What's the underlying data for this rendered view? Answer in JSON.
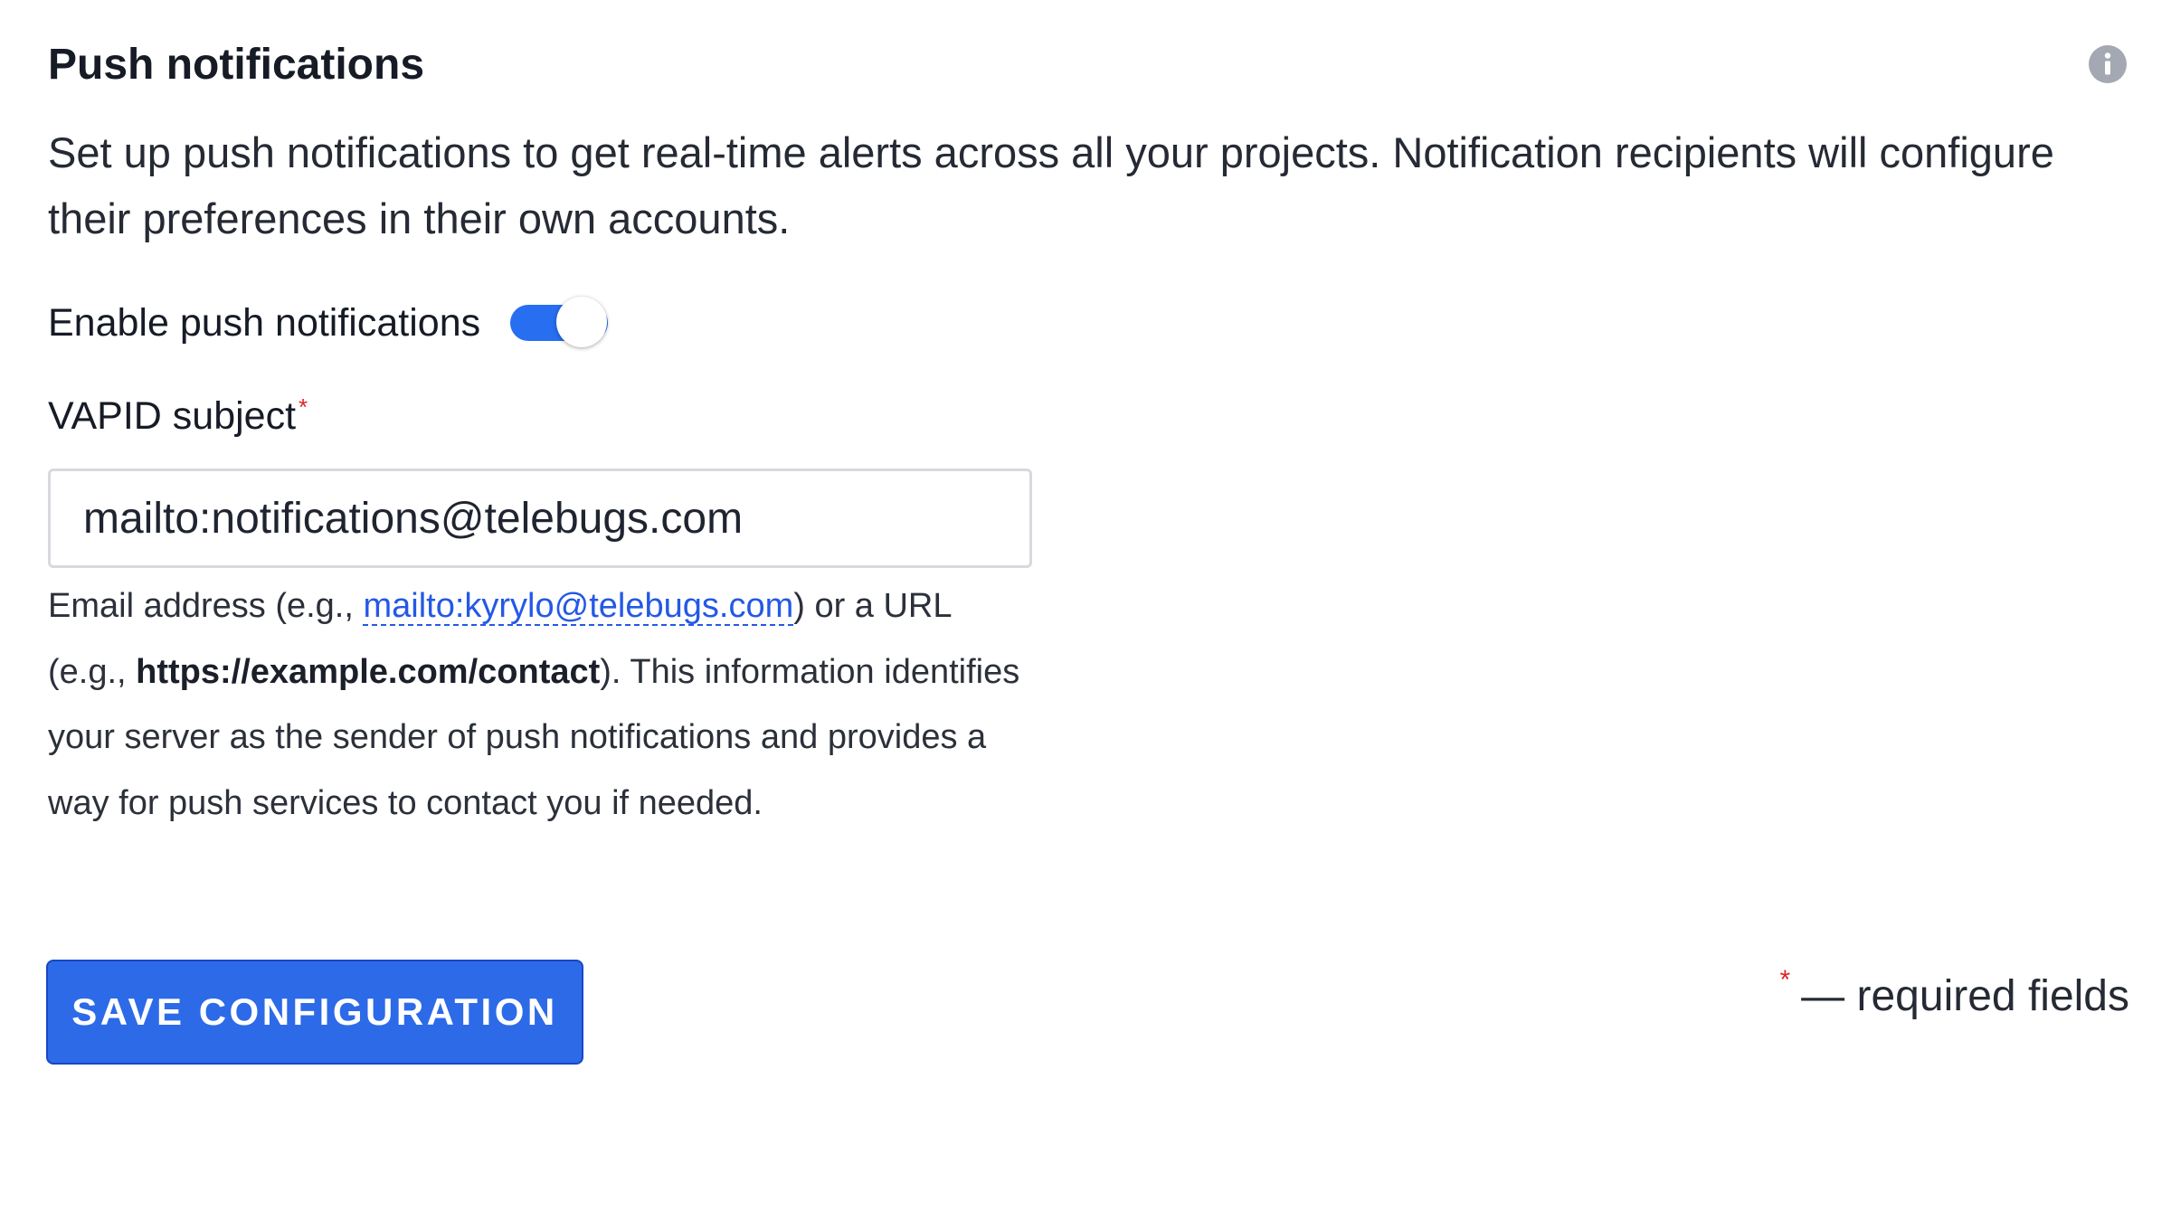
{
  "header": {
    "title": "Push notifications",
    "info_icon": "info-circle-icon"
  },
  "description": "Set up push notifications to get real-time alerts across all your projects. Notification recipients will configure their preferences in their own accounts.",
  "toggle": {
    "label": "Enable push notifications",
    "enabled": true,
    "on_color": "#276ef1"
  },
  "vapid": {
    "label": "VAPID subject",
    "required_mark": "*",
    "value": "mailto:notifications@telebugs.com",
    "help": {
      "prefix": "Email address (e.g., ",
      "link_text": "mailto:kyrylo@telebugs.com",
      "middle": ") or a URL (e.g., ",
      "example_url": "https://example.com/contact",
      "suffix": "). This information identifies your server as the sender of push notifications and provides a way for push services to contact you if needed."
    }
  },
  "actions": {
    "save_label": "SAVE CONFIGURATION",
    "save_color": "#2c6ae8"
  },
  "footer": {
    "required_mark": "*",
    "required_note": "— required fields"
  }
}
